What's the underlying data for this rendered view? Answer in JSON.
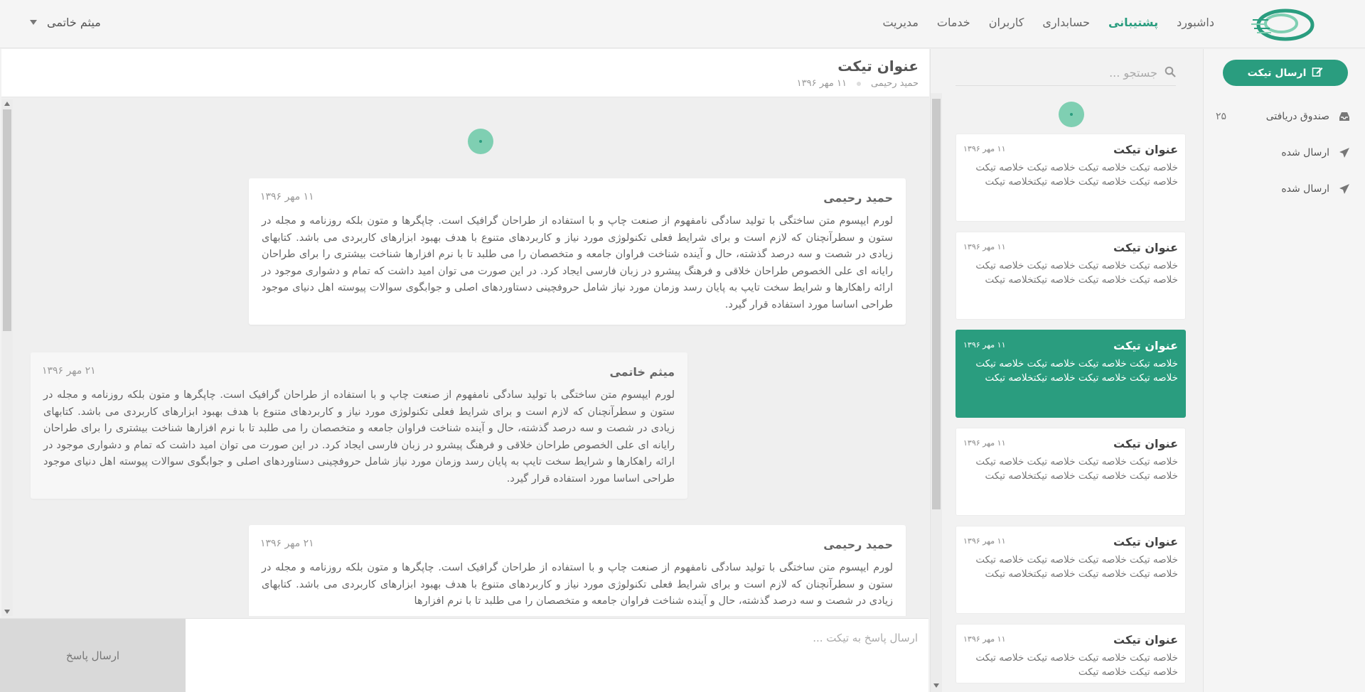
{
  "nav": {
    "items": [
      {
        "label": "داشبورد",
        "active": false
      },
      {
        "label": "پشتیبانی",
        "active": true
      },
      {
        "label": "حسابداری",
        "active": false
      },
      {
        "label": "کاربران",
        "active": false
      },
      {
        "label": "خدمات",
        "active": false
      },
      {
        "label": "مدیریت",
        "active": false
      }
    ],
    "user_name": "میثم خاتمی"
  },
  "sidebar": {
    "send_ticket_label": "ارسال تیکت",
    "items": [
      {
        "label": "صندوق دریافتی",
        "count": "۲۵",
        "icon": "inbox-icon"
      },
      {
        "label": "ارسال شده",
        "count": "",
        "icon": "send-icon"
      },
      {
        "label": "ارسال شده",
        "count": "",
        "icon": "send-icon"
      }
    ]
  },
  "search": {
    "placeholder": "جستجو ..."
  },
  "tickets": [
    {
      "title": "عنوان تیکت",
      "date": "۱۱ مهر ۱۳۹۶",
      "summary": "خلاصه تیکت خلاصه تیکت خلاصه تیکت خلاصه تیکت خلاصه تیکت خلاصه تیکت خلاصه تیکتخلاصه تیکت",
      "selected": false
    },
    {
      "title": "عنوان تیکت",
      "date": "۱۱ مهر ۱۳۹۶",
      "summary": "خلاصه تیکت خلاصه تیکت خلاصه تیکت خلاصه تیکت خلاصه تیکت خلاصه تیکت خلاصه تیکتخلاصه تیکت",
      "selected": false
    },
    {
      "title": "عنوان تیکت",
      "date": "۱۱ مهر ۱۳۹۶",
      "summary": "خلاصه تیکت خلاصه تیکت خلاصه تیکت خلاصه تیکت خلاصه تیکت خلاصه تیکت خلاصه تیکتخلاصه تیکت",
      "selected": true
    },
    {
      "title": "عنوان تیکت",
      "date": "۱۱ مهر ۱۳۹۶",
      "summary": "خلاصه تیکت خلاصه تیکت خلاصه تیکت خلاصه تیکت خلاصه تیکت خلاصه تیکت خلاصه تیکتخلاصه تیکت",
      "selected": false
    },
    {
      "title": "عنوان تیکت",
      "date": "۱۱ مهر ۱۳۹۶",
      "summary": "خلاصه تیکت خلاصه تیکت خلاصه تیکت خلاصه تیکت خلاصه تیکت خلاصه تیکت خلاصه تیکتخلاصه تیکت",
      "selected": false
    },
    {
      "title": "عنوان تیکت",
      "date": "۱۱ مهر ۱۳۹۶",
      "summary": "خلاصه تیکت خلاصه تیکت خلاصه تیکت خلاصه تیکت خلاصه تیکت خلاصه تیکت",
      "selected": false
    }
  ],
  "conversation": {
    "title": "عنوان تیکت",
    "author": "حمید رحیمی",
    "date": "۱۱ مهر ۱۳۹۶",
    "messages": [
      {
        "author": "حمید رحیمی",
        "date": "۱۱ مهر ۱۳۹۶",
        "mine": false,
        "body": "لورم ایپسوم متن ساختگی با تولید سادگی نامفهوم از صنعت چاپ و با استفاده از طراحان گرافیک است. چاپگرها و متون بلکه روزنامه و مجله در ستون و سطرآنچنان که لازم است و برای شرایط فعلی تکنولوژی مورد نیاز و کاربردهای متنوع با هدف بهبود ابزارهای کاربردی می باشد. کتابهای زیادی در شصت و سه درصد گذشته، حال و آینده شناخت فراوان جامعه و متخصصان را می طلبد تا با نرم افزارها شناخت بیشتری را برای طراحان رایانه ای علی الخصوص طراحان خلاقی و فرهنگ پیشرو در زبان فارسی ایجاد کرد. در این صورت می توان امید داشت که تمام و دشواری موجود در ارائه راهکارها و شرایط سخت تایپ به پایان رسد وزمان مورد نیاز شامل حروفچینی دستاوردهای اصلی و جوابگوی سوالات پیوسته اهل دنیای موجود طراحی اساسا مورد استفاده قرار گیرد."
      },
      {
        "author": "میثم خاتمی",
        "date": "۲۱ مهر ۱۳۹۶",
        "mine": true,
        "body": "لورم ایپسوم متن ساختگی با تولید سادگی نامفهوم از صنعت چاپ و با استفاده از طراحان گرافیک است. چاپگرها و متون بلکه روزنامه و مجله در ستون و سطرآنچنان که لازم است و برای شرایط فعلی تکنولوژی مورد نیاز و کاربردهای متنوع با هدف بهبود ابزارهای کاربردی می باشد. کتابهای زیادی در شصت و سه درصد گذشته، حال و آینده شناخت فراوان جامعه و متخصصان را می طلبد تا با نرم افزارها شناخت بیشتری را برای طراحان رایانه ای علی الخصوص طراحان خلاقی و فرهنگ پیشرو در زبان فارسی ایجاد کرد. در این صورت می توان امید داشت که تمام و دشواری موجود در ارائه راهکارها و شرایط سخت تایپ به پایان رسد وزمان مورد نیاز شامل حروفچینی دستاوردهای اصلی و جوابگوی سوالات پیوسته اهل دنیای موجود طراحی اساسا مورد استفاده قرار گیرد."
      },
      {
        "author": "حمید رحیمی",
        "date": "۲۱ مهر ۱۳۹۶",
        "mine": false,
        "body": "لورم ایپسوم متن ساختگی با تولید سادگی نامفهوم از صنعت چاپ و با استفاده از طراحان گرافیک است. چاپگرها و متون بلکه روزنامه و مجله در ستون و سطرآنچنان که لازم است و برای شرایط فعلی تکنولوژی مورد نیاز و کاربردهای متنوع با هدف بهبود ابزارهای کاربردی می باشد. کتابهای زیادی در شصت و سه درصد گذشته، حال و آینده شناخت فراوان جامعه و متخصصان را می طلبد تا با نرم افزارها"
      }
    ]
  },
  "reply": {
    "placeholder": "ارسال پاسخ به تیکت ...",
    "button_label": "ارسال پاسخ"
  },
  "colors": {
    "accent": "#2a9d7f",
    "accent_light": "#7fcfb2",
    "background": "#f2f2f2"
  }
}
